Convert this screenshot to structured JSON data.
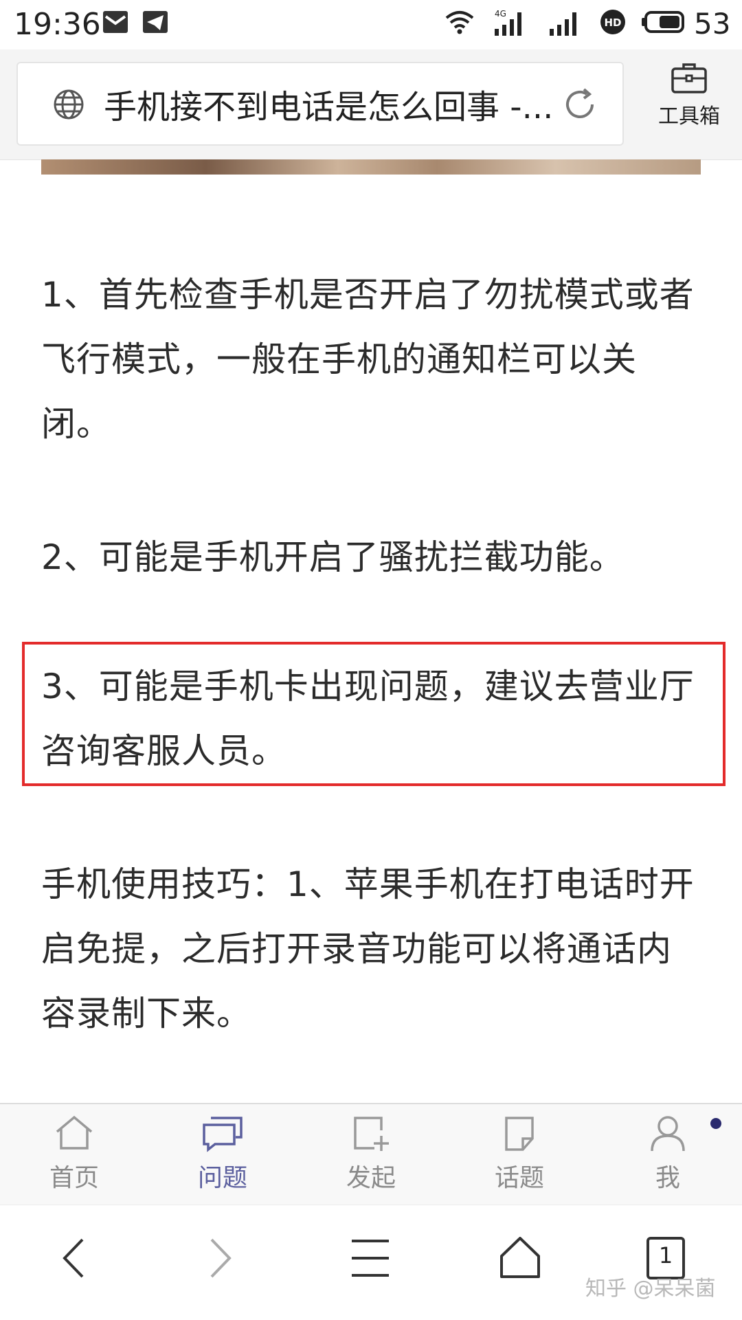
{
  "status_bar": {
    "time": "19:36",
    "battery": "53",
    "icons": [
      "mail-icon",
      "telegram-icon",
      "wifi-icon",
      "4g-signal-icon",
      "signal-icon",
      "hd-icon",
      "battery-icon"
    ]
  },
  "url_bar": {
    "title": "手机接不到电话是怎么回事 -...",
    "toolbox_label": "工具箱"
  },
  "article": {
    "paragraphs": [
      "1、首先检查手机是否开启了勿扰模式或者飞行模式，一般在手机的通知栏可以关闭。",
      "2、可能是手机开启了骚扰拦截功能。",
      "3、可能是手机卡出现问题，建议去营业厅咨询客服人员。",
      "手机使用技巧：1、苹果手机在打电话时开启免提，之后打开录音功能可以将通话内容录制下来。"
    ],
    "highlight_color": "#e32b2b"
  },
  "tab_bar": {
    "tabs": [
      {
        "label": "首页",
        "icon": "home-icon"
      },
      {
        "label": "问题",
        "icon": "question-chat-icon",
        "active": true
      },
      {
        "label": "发起",
        "icon": "compose-icon"
      },
      {
        "label": "话题",
        "icon": "topic-icon"
      },
      {
        "label": "我",
        "icon": "profile-icon"
      }
    ],
    "active_color": "#5b5f9e"
  },
  "nav_bar": {
    "tab_count": "1",
    "icons": [
      "back-icon",
      "forward-icon",
      "menu-icon",
      "home-icon",
      "tabs-icon"
    ]
  },
  "watermark": "知乎 @呆呆菌"
}
